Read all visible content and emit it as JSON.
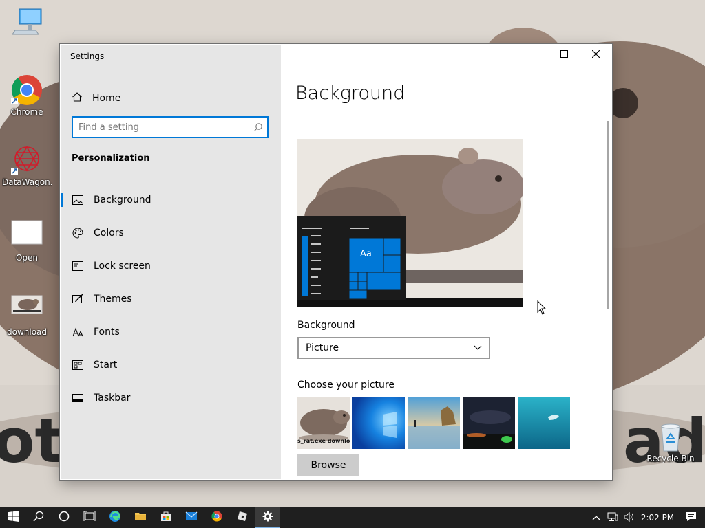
{
  "desktop": {
    "icons": [
      {
        "label": ""
      },
      {
        "label": "Chrome"
      },
      {
        "label": "DataWagon..."
      },
      {
        "label": "Open"
      },
      {
        "label": "download"
      },
      {
        "label": "Recycle Bin"
      }
    ],
    "wallpaper_text": "ot_                                                                          ade"
  },
  "window": {
    "title": "Settings",
    "controls": {
      "minimize": "minimize-icon",
      "maximize": "maximize-icon",
      "close": "close-icon"
    }
  },
  "nav": {
    "home_label": "Home",
    "search_placeholder": "Find a setting",
    "section_title": "Personalization",
    "items": [
      {
        "label": "Background",
        "icon": "picture-icon",
        "selected": true
      },
      {
        "label": "Colors",
        "icon": "palette-icon"
      },
      {
        "label": "Lock screen",
        "icon": "lock-screen-icon"
      },
      {
        "label": "Themes",
        "icon": "themes-icon"
      },
      {
        "label": "Fonts",
        "icon": "fonts-icon"
      },
      {
        "label": "Start",
        "icon": "start-icon"
      },
      {
        "label": "Taskbar",
        "icon": "taskbar-icon"
      }
    ]
  },
  "main": {
    "title": "Background",
    "preview": {
      "tile_label": "Aa"
    },
    "background_label": "Background",
    "background_value": "Picture",
    "choose_label": "Choose your picture",
    "thumb_caption": "s_rat.exe downlo",
    "browse_label": "Browse"
  },
  "taskbar": {
    "time": "2:02 PM"
  },
  "colors": {
    "accent": "#0078d7",
    "nav_bg": "#e6e6e6",
    "taskbar_bg": "#1f1f1f"
  }
}
